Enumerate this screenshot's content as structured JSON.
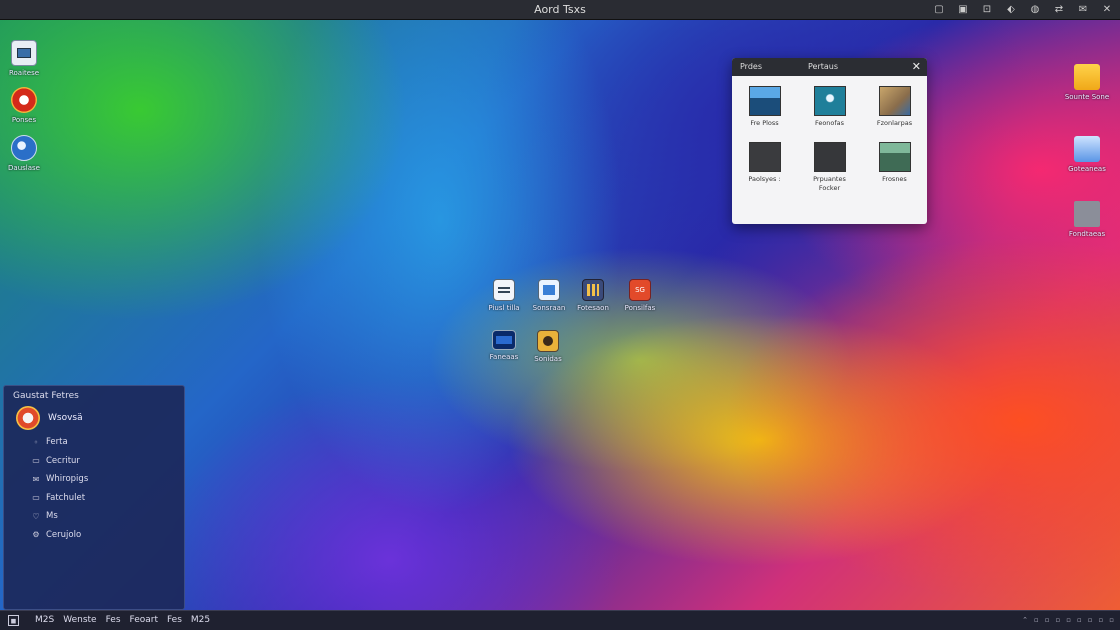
{
  "window": {
    "title": "Aord Tsxs"
  },
  "top_tray_icons": [
    "window-icon",
    "camera-icon",
    "screen-icon",
    "pin-icon",
    "globe-icon",
    "arrows-icon",
    "mail-icon",
    "close-icon"
  ],
  "desktop_left": [
    {
      "label": "Roaitese",
      "icon": "computer-icon"
    },
    {
      "label": "Ponses",
      "icon": "browser-icon"
    },
    {
      "label": "Dauslase",
      "icon": "globe-icon"
    }
  ],
  "desktop_right": [
    {
      "label": "Sounte Sone",
      "icon": "folder-icon"
    },
    {
      "label": "Goteaneas",
      "icon": "folder-blue-icon"
    },
    {
      "label": "Fondtaeas",
      "icon": "disk-icon"
    }
  ],
  "center_icons": [
    {
      "label": "Piusl tilla",
      "icon": "document-icon"
    },
    {
      "label": "Sonsraan",
      "icon": "image-icon"
    },
    {
      "label": "Fotesaon",
      "icon": "apps-icon"
    },
    {
      "label": "Ponsilfas",
      "icon": "sg-app-icon"
    },
    {
      "label": "Faneaas",
      "icon": "monitor-icon"
    },
    {
      "label": "Sonidas",
      "icon": "paint-icon"
    }
  ],
  "photos_window": {
    "tab1": "Prdes",
    "tab2": "Pertaus",
    "close": "✕",
    "thumbs": [
      {
        "caption": "Fre Ploss",
        "color": "#1b4d7a"
      },
      {
        "caption": "Feonofas",
        "color": "#1f7f9a"
      },
      {
        "caption": "Fzonlarpas",
        "color": "#8a6d4b"
      },
      {
        "caption": "Paolsyes :",
        "color": "#3a3b3e"
      },
      {
        "caption": "Prpuantes\nFocker",
        "color": "#36373a"
      },
      {
        "caption": "Frosnes",
        "color": "#3f6b55"
      }
    ]
  },
  "start_menu": {
    "title": "Gaustat Fetres",
    "user": "Wsovsä",
    "items": [
      {
        "label": "Ferta",
        "icon": "search-icon"
      },
      {
        "label": "Cecritur",
        "icon": "document-icon"
      },
      {
        "label": "Whiropigs",
        "icon": "mail-icon"
      },
      {
        "label": "Fatchulet",
        "icon": "folder-icon"
      },
      {
        "label": "Ms",
        "icon": "heart-icon"
      },
      {
        "label": "Cerujolo",
        "icon": "settings-icon"
      }
    ]
  },
  "taskbar": {
    "start_label": "◼",
    "apps": [
      "M2S",
      "Wenste",
      "Fes",
      "Feoart",
      "Fes",
      "M25"
    ],
    "tray": [
      "⌃",
      "▫",
      "▫",
      "▫",
      "▫",
      "▫",
      "▫",
      "▫",
      "▫"
    ]
  }
}
